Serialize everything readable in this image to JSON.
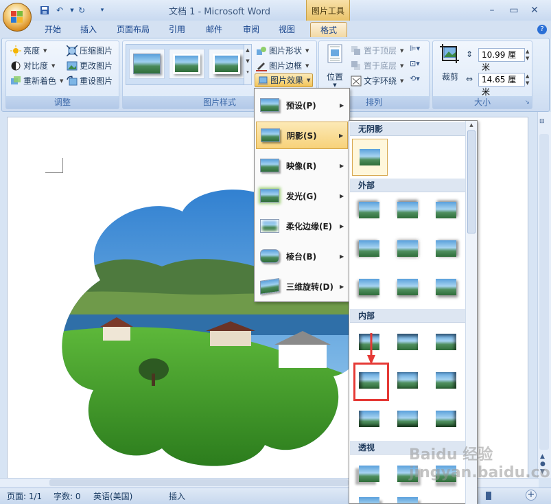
{
  "window": {
    "title": "文档 1 - Microsoft Word",
    "contextual_tab_group": "图片工具"
  },
  "tabs": [
    "开始",
    "插入",
    "页面布局",
    "引用",
    "邮件",
    "审阅",
    "视图",
    "格式"
  ],
  "ribbon": {
    "adjust": {
      "label": "调整",
      "brightness": "亮度",
      "contrast": "对比度",
      "recolor": "重新着色",
      "compress": "压缩图片",
      "change": "更改图片",
      "reset": "重设图片"
    },
    "picture_styles": {
      "label": "图片样式",
      "shape": "图片形状",
      "border": "图片边框",
      "effects": "图片效果"
    },
    "arrange": {
      "label": "排列",
      "position": "位置",
      "bring_front": "置于顶层",
      "send_back": "置于底层",
      "text_wrap": "文字环绕"
    },
    "size": {
      "label": "大小",
      "crop": "裁剪",
      "height": "10.99 厘米",
      "width": "14.65 厘米"
    }
  },
  "effects_menu": {
    "items": [
      {
        "label": "预设(P)"
      },
      {
        "label": "阴影(S)"
      },
      {
        "label": "映像(R)"
      },
      {
        "label": "发光(G)"
      },
      {
        "label": "柔化边缘(E)"
      },
      {
        "label": "棱台(B)"
      },
      {
        "label": "三维旋转(D)"
      }
    ]
  },
  "shadow_gallery": {
    "sections": {
      "none": "无阴影",
      "outer": "外部",
      "inner": "内部",
      "perspective": "透视"
    }
  },
  "status": {
    "page": "页面: 1/1",
    "words": "字数: 0",
    "language": "英语(美国)",
    "mode": "插入"
  },
  "watermark": "Baidu 经验  jingyan.baidu.com",
  "colors": {
    "accent": "#f7d27a",
    "highlight": "#e53935"
  }
}
